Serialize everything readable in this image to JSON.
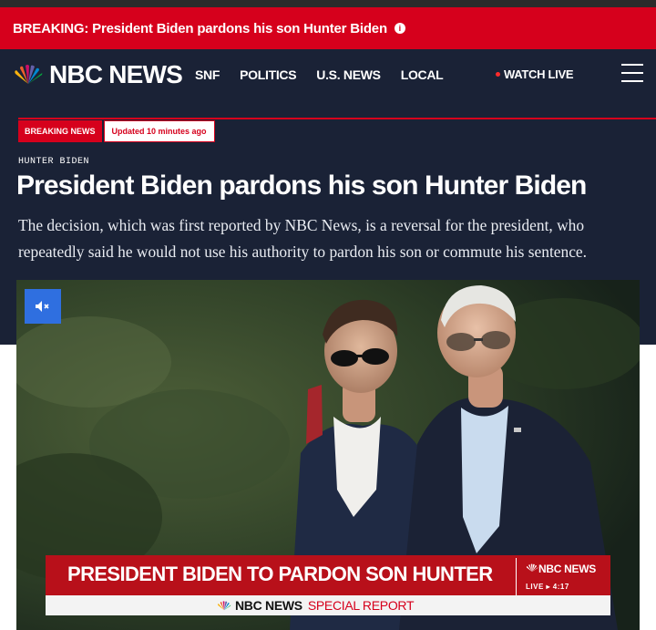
{
  "breaking_banner": {
    "text": "BREAKING: President Biden pardons his son Hunter Biden",
    "icon": "info-icon"
  },
  "nav": {
    "logo_text": "NBC NEWS",
    "links": [
      "SNF",
      "POLITICS",
      "U.S. NEWS",
      "LOCAL"
    ],
    "watch_live": "WATCH LIVE",
    "menu_icon": "hamburger-menu-icon"
  },
  "article": {
    "badge_label": "BREAKING NEWS",
    "updated": "Updated 10 minutes ago",
    "kicker": "HUNTER BIDEN",
    "headline": "President Biden pardons his son Hunter Biden",
    "dek": "The decision, which was first reported by NBC News, is a reversal for the president, who repeatedly said he would not use his authority to pardon his son or commute his sentence."
  },
  "video": {
    "mute_icon": "speaker-muted-icon",
    "lower_third": {
      "title": "PRESIDENT BIDEN TO PARDON SON HUNTER",
      "brand": "NBC NEWS",
      "live": "LIVE",
      "time": "4:17",
      "sub_brand": "NBC NEWS",
      "sub_label": "SPECIAL REPORT"
    }
  },
  "colors": {
    "brand_red": "#d6001c",
    "navy": "#1a2236",
    "mute_blue": "#2f6fe0"
  }
}
